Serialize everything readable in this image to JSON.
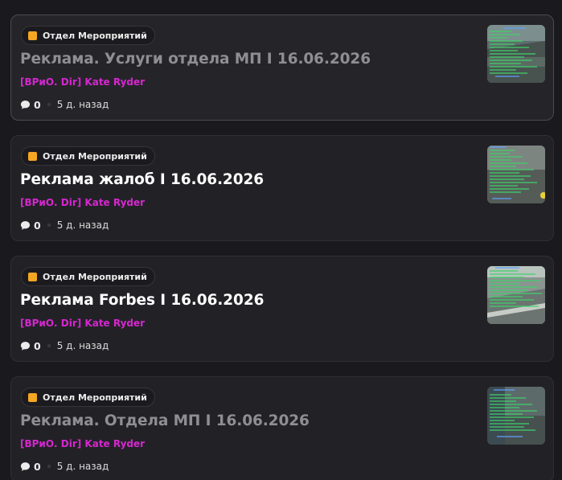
{
  "posts": [
    {
      "category": "Отдел Мероприятий",
      "title": "Реклама. Услуги отдела МП I 16.06.2026",
      "author": "[ВРиО. Dir] Kate Ryder",
      "comments": "0",
      "time": "5 д. назад",
      "read": true
    },
    {
      "category": "Отдел Мероприятий",
      "title": "Реклама жалоб I 16.06.2026",
      "author": "[ВРиО. Dir] Kate Ryder",
      "comments": "0",
      "time": "5 д. назад",
      "read": false
    },
    {
      "category": "Отдел Мероприятий",
      "title": "Реклама Forbes I 16.06.2026",
      "author": "[ВРиО. Dir] Kate Ryder",
      "comments": "0",
      "time": "5 д. назад",
      "read": false
    },
    {
      "category": "Отдел Мероприятий",
      "title": "Реклама. Отдела МП I 16.06.2026",
      "author": "[ВРиО. Dir] Kate Ryder",
      "comments": "0",
      "time": "5 д. назад",
      "read": true
    }
  ],
  "colors": {
    "background": "#1a1a1e",
    "card": "#222226",
    "author": "#d627d0",
    "category_icon": "#f5a623",
    "title_read": "#8e8e93",
    "title_unread": "#ffffff"
  },
  "icons": {
    "category": "orange-square-icon",
    "comments": "speech-bubble-icon"
  }
}
